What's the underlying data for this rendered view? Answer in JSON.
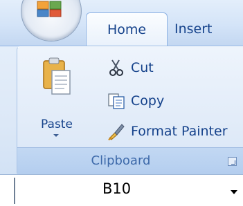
{
  "tabs": [
    {
      "label": "Home",
      "active": true
    },
    {
      "label": "Insert",
      "active": false
    }
  ],
  "clipboard": {
    "group_label": "Clipboard",
    "paste_label": "Paste",
    "cut_label": "Cut",
    "copy_label": "Copy",
    "format_painter_label": "Format Painter"
  },
  "name_box": {
    "value": "B10"
  },
  "colors": {
    "tab_text": "#15428b",
    "group_label": "#3e6aaa",
    "ribbon_bg": "#dfeaf8"
  },
  "icons": {
    "office": "office-button-icon",
    "paste": "clipboard-paste-icon",
    "cut": "scissors-icon",
    "copy": "copy-icon",
    "format_painter": "paintbrush-icon",
    "launcher": "dialog-launcher-icon",
    "dropdown": "chevron-down-icon"
  }
}
